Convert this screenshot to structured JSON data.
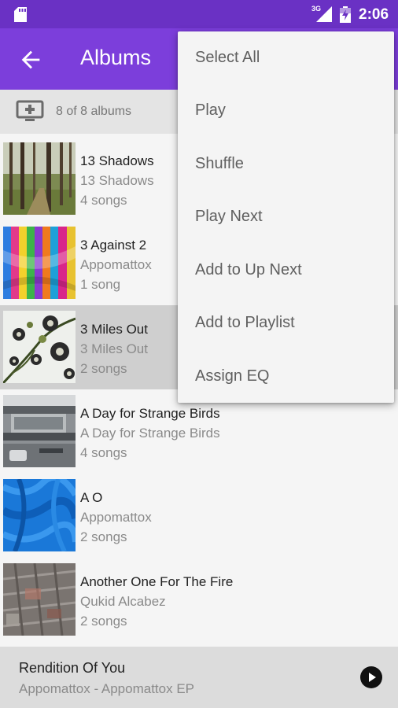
{
  "status_bar": {
    "network": "3G",
    "time": "2:06",
    "icons": [
      "sd-card-icon",
      "signal-icon",
      "battery-charging-icon"
    ]
  },
  "app_bar": {
    "title": "Albums",
    "back_icon": "arrow-back-icon"
  },
  "sub_bar": {
    "cast_icon": "cast-add-icon",
    "count": "8 of 8 albums"
  },
  "albums": [
    {
      "title": "13 Shadows",
      "artist": "13 Shadows",
      "songs": "4 songs"
    },
    {
      "title": "3 Against 2",
      "artist": "Appomattox",
      "songs": "1 song"
    },
    {
      "title": "3 Miles Out",
      "artist": "3 Miles Out",
      "songs": "2 songs",
      "selected": true
    },
    {
      "title": "A Day for Strange Birds",
      "artist": "A Day for Strange Birds",
      "songs": "4 songs"
    },
    {
      "title": "A O",
      "artist": "Appomattox",
      "songs": "2 songs"
    },
    {
      "title": "Another One For The Fire",
      "artist": "Qukid Alcabez",
      "songs": "2 songs"
    }
  ],
  "now_playing": {
    "title": "Rendition Of You",
    "subtitle": "Appomattox - Appomattox EP",
    "play_icon": "play-circle-icon"
  },
  "menu": {
    "items": [
      "Select All",
      "Play",
      "Shuffle",
      "Play Next",
      "Add to Up Next",
      "Add to Playlist",
      "Assign EQ"
    ]
  },
  "colors": {
    "status_bar": "#6a31c4",
    "app_bar": "#7c3edb",
    "selected_row": "#cfcfcf",
    "now_playing_bg": "#dcdcdc"
  }
}
